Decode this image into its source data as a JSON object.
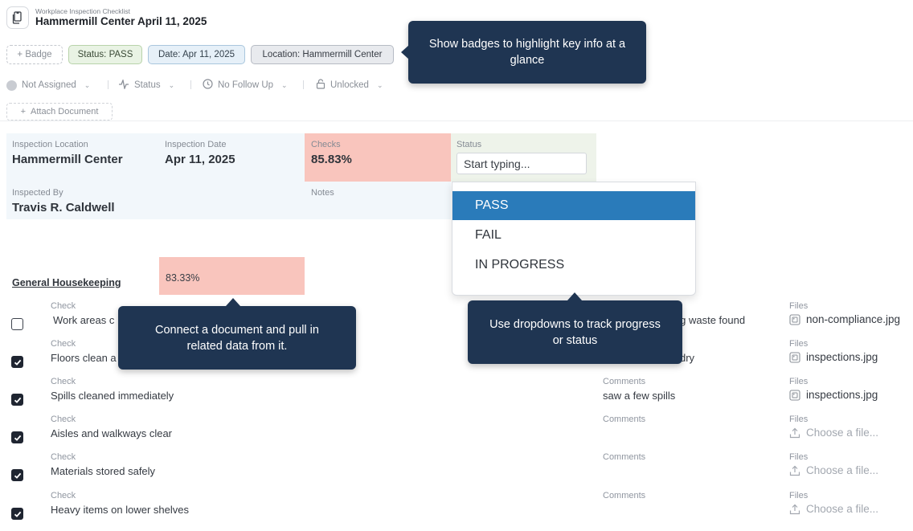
{
  "header": {
    "subtitle": "Workplace Inspection Checklist",
    "title": "Hammermill Center April 11, 2025"
  },
  "badges": {
    "add_label": "+ Badge",
    "status": "Status: PASS",
    "date": "Date: Apr 11, 2025",
    "location": "Location: Hammermill Center"
  },
  "toolbar": {
    "assignee": "Not Assigned",
    "status": "Status",
    "follow_up": "No Follow Up",
    "lock": "Unlocked",
    "attach": "Attach Document"
  },
  "info": {
    "location_label": "Inspection Location",
    "location_value": "Hammermill Center",
    "date_label": "Inspection Date",
    "date_value": "Apr 11, 2025",
    "checks_label": "Checks",
    "checks_value": "85.83%",
    "status_label": "Status",
    "status_placeholder": "Start typing...",
    "inspected_by_label": "Inspected By",
    "inspected_by_value": "Travis R. Caldwell",
    "notes_label": "Notes"
  },
  "status_dropdown": {
    "options": [
      "PASS",
      "FAIL",
      "IN PROGRESS"
    ],
    "highlighted": "PASS"
  },
  "section": {
    "title": "General Housekeeping",
    "score": "83.33%"
  },
  "columns": {
    "check": "Check",
    "comments": "Comments",
    "files": "Files"
  },
  "rows": [
    {
      "checked": false,
      "check": "Work areas c",
      "comment": "ing waste found",
      "file": "non-compliance.jpg",
      "has_file": true
    },
    {
      "checked": true,
      "check": "Floors clean a",
      "comment": "dry",
      "file": "inspections.jpg",
      "has_file": true
    },
    {
      "checked": true,
      "check": "Spills cleaned immediately",
      "comment": "saw a few spills",
      "file": "inspections.jpg",
      "has_file": true
    },
    {
      "checked": true,
      "check": "Aisles and walkways clear",
      "comment": "",
      "file": "Choose a file...",
      "has_file": false
    },
    {
      "checked": true,
      "check": "Materials stored safely",
      "comment": "",
      "file": "Choose a file...",
      "has_file": false
    },
    {
      "checked": true,
      "check": "Heavy items on lower shelves",
      "comment": "",
      "file": "Choose a file...",
      "has_file": false
    }
  ],
  "tooltips": {
    "badges": "Show badges to highlight key info at a glance",
    "document": "Connect a document and pull in related data from it.",
    "dropdowns": "Use dropdowns to track progress or status"
  },
  "colors": {
    "tooltip_bg": "#1f3552",
    "selected_option": "#2a7bba",
    "score_fill": "#f9c5bd",
    "info_panel": "#f2f7fb"
  }
}
